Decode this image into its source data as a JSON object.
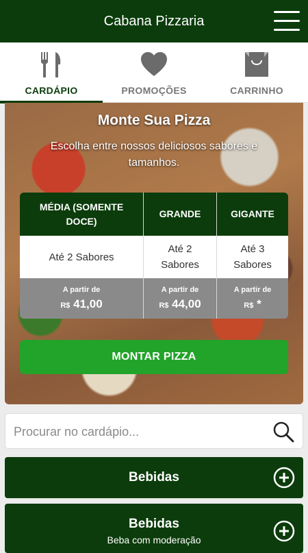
{
  "header": {
    "title": "Cabana Pizzaria",
    "menu_icon": "hamburger-menu-icon"
  },
  "tabs": [
    {
      "label": "CARDÁPIO",
      "icon": "fork-knife-icon",
      "active": true
    },
    {
      "label": "PROMOÇÕES",
      "icon": "heart-icon",
      "active": false
    },
    {
      "label": "CARRINHO",
      "icon": "shopping-bag-icon",
      "active": false
    }
  ],
  "hero": {
    "title": "Monte Sua Pizza",
    "subtitle": "Escolha entre nossos deliciosos sabores e tamanhos.",
    "sizes": [
      {
        "name": "MÉDIA (SOMENTE DOCE)",
        "flavors": "Até 2 Sabores",
        "from": "A partir de",
        "currency": "R$",
        "price": "41,00"
      },
      {
        "name": "GRANDE",
        "flavors": "Até 2 Sabores",
        "from": "A partir de",
        "currency": "R$",
        "price": "44,00"
      },
      {
        "name": "GIGANTE",
        "flavors": "Até 3 Sabores",
        "from": "A partir de",
        "currency": "R$",
        "price": "*"
      }
    ],
    "button": "MONTAR PIZZA"
  },
  "search": {
    "placeholder": "Procurar no cardápio...",
    "value": ""
  },
  "categories": [
    {
      "name": "Bebidas",
      "description": ""
    },
    {
      "name": "Bebidas",
      "description": "Beba com moderação"
    }
  ],
  "colors": {
    "primary": "#0c3c0c",
    "accent": "#22a32a",
    "price_bg": "#8a8a8a"
  }
}
